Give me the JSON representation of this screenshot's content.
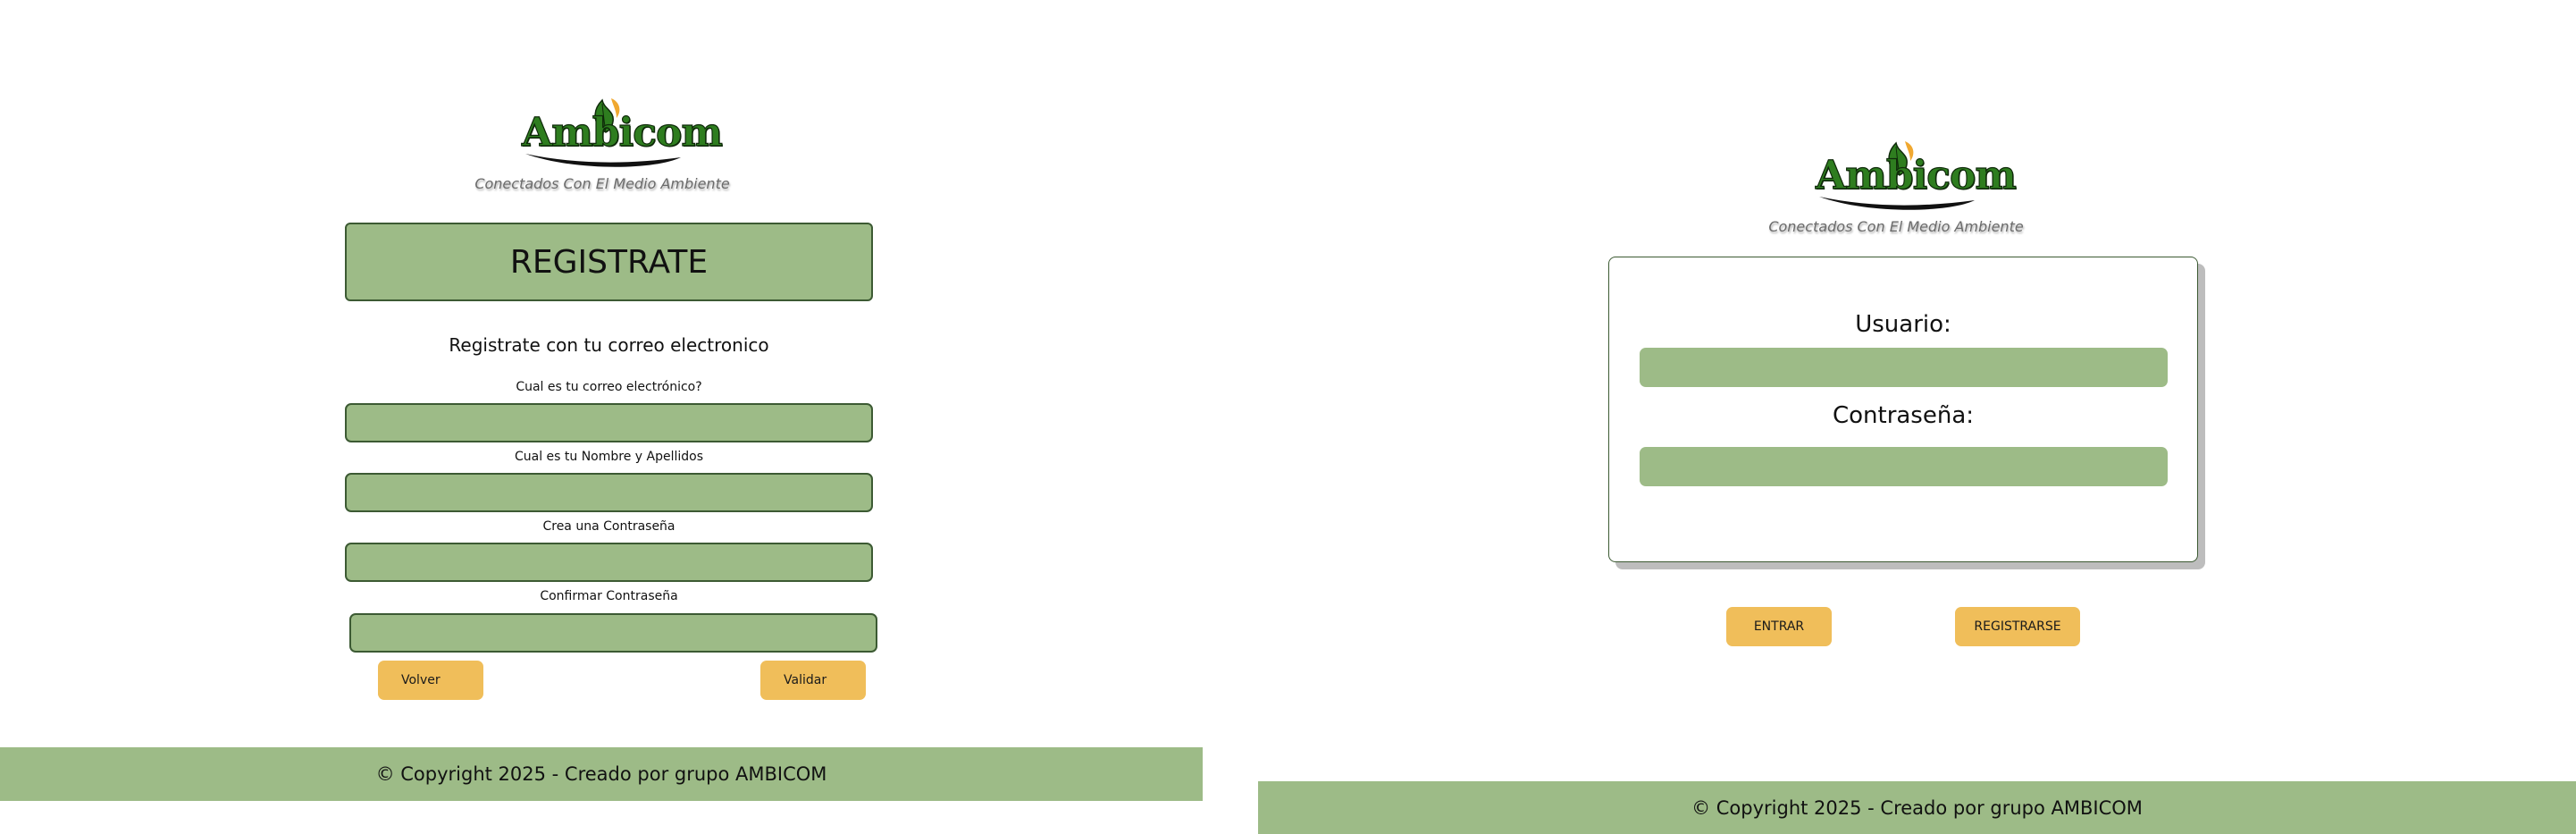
{
  "brand": {
    "name": "Ambicom",
    "tagline": "Conectados Con El Medio Ambiente"
  },
  "register": {
    "title": "REGISTRATE",
    "subtitle": "Registrate con tu correo electronico",
    "fields": [
      {
        "label": "Cual es tu correo electrónico?",
        "value": ""
      },
      {
        "label": "Cual es tu Nombre y Apellidos",
        "value": ""
      },
      {
        "label": "Crea una Contraseña",
        "value": ""
      },
      {
        "label": "Confirmar Contraseña",
        "value": ""
      }
    ],
    "back_label": "Volver",
    "validate_label": "Validar",
    "footer": "© Copyright 2025 - Creado por grupo AMBICOM"
  },
  "login": {
    "user_label": "Usuario:",
    "user_value": "",
    "password_label": "Contraseña:",
    "password_value": "",
    "enter_label": "ENTRAR",
    "register_label": "REGISTRARSE",
    "footer": "© Copyright 2025 - Creado por grupo AMBICOM"
  },
  "colors": {
    "green": "#9dbb87",
    "dark_green": "#3c5a33",
    "button_yellow": "#f0be5a",
    "logo_green": "#2e7d1f"
  },
  "icons": {
    "logo": "leaf-logo-icon"
  }
}
